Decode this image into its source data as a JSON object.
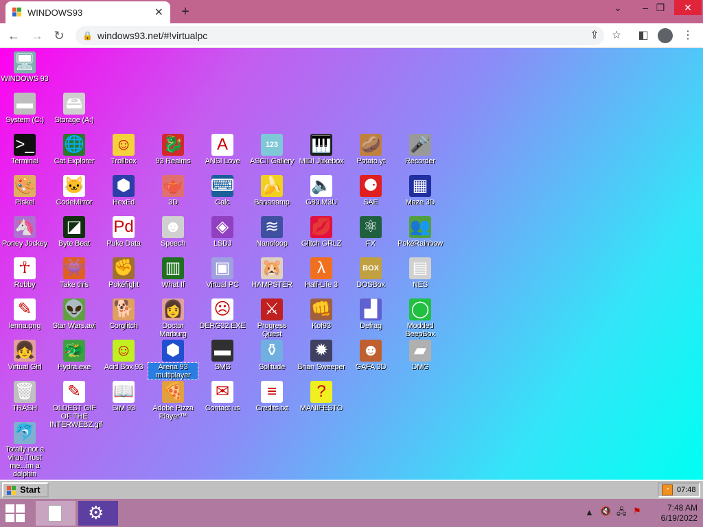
{
  "browser": {
    "tab_title": "WINDOWS93",
    "url": "windows93.net/#!virtualpc",
    "newtab": "+",
    "close_tab": "✕"
  },
  "desktop": {
    "icons": [
      {
        "label": "WINDOWS 93",
        "glyph": "🖥",
        "bg": "#7fb0b0"
      },
      {
        "label": "System (C:)",
        "glyph": "▬",
        "bg": "#bdbdbd"
      },
      {
        "label": "Storage (A:)",
        "glyph": "🖴",
        "bg": "#cfcfcf"
      },
      {
        "label": "Terminal",
        "glyph": ">_",
        "bg": "#101010"
      },
      {
        "label": "Cat Explorer",
        "glyph": "🌐",
        "bg": "#2b7a2b"
      },
      {
        "label": "Trollbox",
        "glyph": "☺",
        "bg": "#f4d23c"
      },
      {
        "label": "93 Realms",
        "glyph": "🐉",
        "bg": "#d12a2a"
      },
      {
        "label": "ANSI Love",
        "glyph": "A",
        "bg": "#ffffff"
      },
      {
        "label": "ASCII Gallery",
        "glyph": "123",
        "bg": "#7ec8d8"
      },
      {
        "label": "MIDI Jukebox",
        "glyph": "🎹",
        "bg": "#222222"
      },
      {
        "label": "Potato.yt",
        "glyph": "🥔",
        "bg": "#c08040"
      },
      {
        "label": "Recorder",
        "glyph": "🎤",
        "bg": "#999999"
      },
      {
        "label": "Piskel",
        "glyph": "🎨",
        "bg": "#e0b060"
      },
      {
        "label": "CodeMirror",
        "glyph": "🐱",
        "bg": "#ffffff"
      },
      {
        "label": "HexEd",
        "glyph": "⬢",
        "bg": "#2c3fa8"
      },
      {
        "label": "3D",
        "glyph": "🫖",
        "bg": "#e07070"
      },
      {
        "label": "Calc",
        "glyph": "⌨",
        "bg": "#1a5f9a"
      },
      {
        "label": "Bananamp",
        "glyph": "🍌",
        "bg": "#f0d020"
      },
      {
        "label": "G80.M3U",
        "glyph": "🔈",
        "bg": "#ffffff"
      },
      {
        "label": "SAE",
        "glyph": "⚈",
        "bg": "#e02020"
      },
      {
        "label": "Maze 3D",
        "glyph": "▦",
        "bg": "#2030a0"
      },
      {
        "label": "Poney Jockey",
        "glyph": "🦄",
        "bg": "#b070d0"
      },
      {
        "label": "Byte Beat",
        "glyph": "◪",
        "bg": "#103010"
      },
      {
        "label": "Puke Data",
        "glyph": "Pd",
        "bg": "#ffffff"
      },
      {
        "label": "Speech",
        "glyph": "☻",
        "bg": "#d0d0d0"
      },
      {
        "label": "LSDJ",
        "glyph": "◈",
        "bg": "#9040c0"
      },
      {
        "label": "Nanoloop",
        "glyph": "≋",
        "bg": "#4050a0"
      },
      {
        "label": "Glitch GRLZ",
        "glyph": "💋",
        "bg": "#e01040"
      },
      {
        "label": "FX",
        "glyph": "⚛",
        "bg": "#206040"
      },
      {
        "label": "PokéRainbow",
        "glyph": "👥",
        "bg": "#50a040"
      },
      {
        "label": "Robby",
        "glyph": "☥",
        "bg": "#ffffff"
      },
      {
        "label": "Take this",
        "glyph": "👾",
        "bg": "#e06020"
      },
      {
        "label": "Pokéfight",
        "glyph": "✊",
        "bg": "#a07030"
      },
      {
        "label": "What If",
        "glyph": "▥",
        "bg": "#207020"
      },
      {
        "label": "Virtual PC",
        "glyph": "▣",
        "bg": "#a0a0e0"
      },
      {
        "label": "HAMPSTER",
        "glyph": "🐹",
        "bg": "#e0d0c0"
      },
      {
        "label": "Half-Life 3",
        "glyph": "λ",
        "bg": "#f07020"
      },
      {
        "label": "DOSBox",
        "glyph": "BOX",
        "bg": "#c0a040"
      },
      {
        "label": "NES",
        "glyph": "▤",
        "bg": "#d0d0d0"
      },
      {
        "label": "lenna.png",
        "glyph": "✎",
        "bg": "#ffffff"
      },
      {
        "label": "Star Wars.avi",
        "glyph": "👽",
        "bg": "#60a040"
      },
      {
        "label": "Corglitch",
        "glyph": "🐕",
        "bg": "#e0a060"
      },
      {
        "label": "Doctor Marburg",
        "glyph": "👩",
        "bg": "#e0a0a0"
      },
      {
        "label": "DERG32.EXE",
        "glyph": "☹",
        "bg": "#ffffff"
      },
      {
        "label": "Progress Quest",
        "glyph": "⚔",
        "bg": "#c02020"
      },
      {
        "label": "Kof93",
        "glyph": "👊",
        "bg": "#a06040"
      },
      {
        "label": "Defrag",
        "glyph": "▟",
        "bg": "#6060d0"
      },
      {
        "label": "Modded BeepBox",
        "glyph": "◯",
        "bg": "#20c040"
      },
      {
        "label": "Virtual Girl",
        "glyph": "👧",
        "bg": "#e0a0a0"
      },
      {
        "label": "Hydra.exe",
        "glyph": "🐲",
        "bg": "#40a040"
      },
      {
        "label": "Acid Box 93",
        "glyph": "☺",
        "bg": "#c0f020"
      },
      {
        "label": "Arena 93 multiplayer",
        "glyph": "⬢",
        "bg": "#2050d0"
      },
      {
        "label": "SMS",
        "glyph": "▬",
        "bg": "#303030"
      },
      {
        "label": "Solitude",
        "glyph": "⚱",
        "bg": "#70b0e0"
      },
      {
        "label": "Brian Sweeper",
        "glyph": "✹",
        "bg": "#404060"
      },
      {
        "label": "GAFA 3D",
        "glyph": "☻",
        "bg": "#c06030"
      },
      {
        "label": "DMG",
        "glyph": "▰",
        "bg": "#b0b0b0"
      },
      {
        "label": "TRASH",
        "glyph": "🗑",
        "bg": "#c0c0c0"
      },
      {
        "label": "OLDEST GIF OF THE INTERWEBZ.gif",
        "glyph": "✎",
        "bg": "#ffffff"
      },
      {
        "label": "SIM 93",
        "glyph": "📖",
        "bg": "#ffffff"
      },
      {
        "label": "Adobe Pizza Player™",
        "glyph": "🍕",
        "bg": "#e0a040"
      },
      {
        "label": "Contact us",
        "glyph": "✉",
        "bg": "#ffffff"
      },
      {
        "label": "Credits.txt",
        "glyph": "≡",
        "bg": "#ffffff"
      },
      {
        "label": "MANIFESTO",
        "glyph": "?",
        "bg": "#f0f020"
      },
      {
        "label": "Totally not a virus.Trust me...im a dolphin",
        "glyph": "🐬",
        "bg": "#80b0d0"
      }
    ]
  },
  "taskbar93": {
    "start_label": "Start",
    "clock": "07:48"
  },
  "os_taskbar": {
    "time": "7:48 AM",
    "date": "6/19/2022"
  }
}
